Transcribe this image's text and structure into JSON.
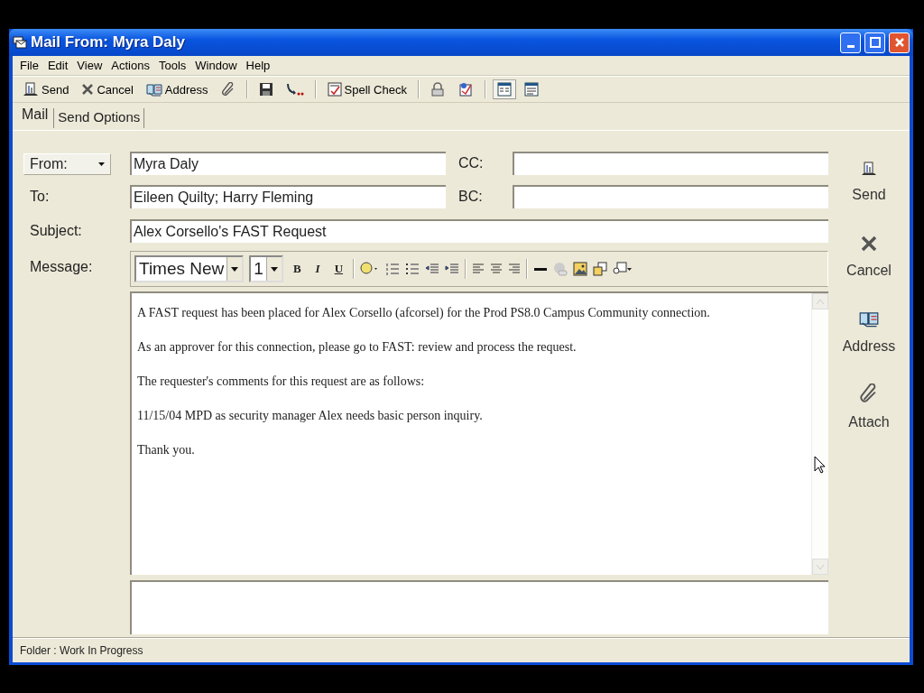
{
  "window": {
    "title": "Mail From: Myra Daly"
  },
  "menu": [
    "File",
    "Edit",
    "View",
    "Actions",
    "Tools",
    "Window",
    "Help"
  ],
  "toolbar": [
    {
      "kind": "text",
      "label": "Send"
    },
    {
      "kind": "text",
      "label": "Cancel"
    },
    {
      "kind": "text",
      "label": "Address"
    },
    {
      "kind": "icon"
    },
    {
      "kind": "separator"
    },
    {
      "kind": "icon"
    },
    {
      "kind": "icon"
    },
    {
      "kind": "separator"
    },
    {
      "kind": "text",
      "label": "Spell Check"
    },
    {
      "kind": "separator"
    },
    {
      "kind": "icon"
    },
    {
      "kind": "icon"
    },
    {
      "kind": "separator"
    },
    {
      "kind": "toggle",
      "selected": true
    },
    {
      "kind": "toggle",
      "selected": false
    }
  ],
  "tabs": [
    {
      "label": "Mail",
      "selected": true
    },
    {
      "label": "Send Options",
      "selected": false
    }
  ],
  "from": {
    "label": "From:",
    "value": "Myra Daly"
  },
  "to": {
    "label": "To:",
    "value": "Eileen Quilty; Harry Fleming"
  },
  "cc": {
    "label": "CC:"
  },
  "bc": {
    "label": "BC:"
  },
  "subject": {
    "label": "Subject:",
    "value": "Alex Corsello's FAST Request"
  },
  "message": {
    "label": "Message:",
    "font": "Times New",
    "size": "1",
    "paragraphs": [
      "A FAST request has been placed for Alex Corsello (afcorsel) for the Prod PS8.0 Campus Community connection.",
      "As an approver for this connection, please go to FAST:  review and process the request.",
      "The requester's comments for this request are as follows:",
      "11/15/04 MPD as security manager Alex needs basic person inquiry.",
      "Thank you."
    ]
  },
  "format_buttons": [
    "B",
    "I",
    "U"
  ],
  "side_actions": [
    "Send",
    "Cancel",
    "Address",
    "Attach"
  ],
  "status_bar": "Folder : Work In Progress"
}
